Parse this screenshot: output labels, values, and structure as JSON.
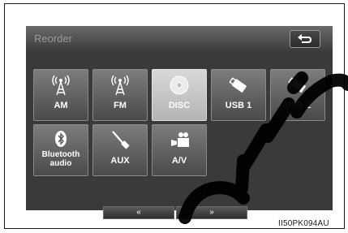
{
  "header": {
    "title": "Reorder",
    "back_icon": "return-arrow-icon"
  },
  "sources": [
    {
      "label": "AM",
      "icon": "radio-tower-icon",
      "state": "normal"
    },
    {
      "label": "FM",
      "icon": "radio-tower-icon",
      "state": "normal"
    },
    {
      "label": "DISC",
      "icon": "disc-icon",
      "state": "selected"
    },
    {
      "label": "USB 1",
      "icon": "usb-stick-icon",
      "state": "normal"
    },
    {
      "label": "USB 2",
      "icon": "usb-stick-icon",
      "state": "normal"
    },
    {
      "label": "Bluetooth\naudio",
      "icon": "bluetooth-icon",
      "state": "normal"
    },
    {
      "label": "AUX",
      "icon": "aux-plug-icon",
      "state": "normal"
    },
    {
      "label": "A/V",
      "icon": "video-camera-icon",
      "state": "normal"
    }
  ],
  "nav": {
    "left_label": "«",
    "right_label": "»"
  },
  "footer": {
    "caption": "II50PK094AU"
  },
  "colors": {
    "screen_bg": "#3a3a3a",
    "tile": "#6a6a6a",
    "selected": "#c8c8c8"
  }
}
